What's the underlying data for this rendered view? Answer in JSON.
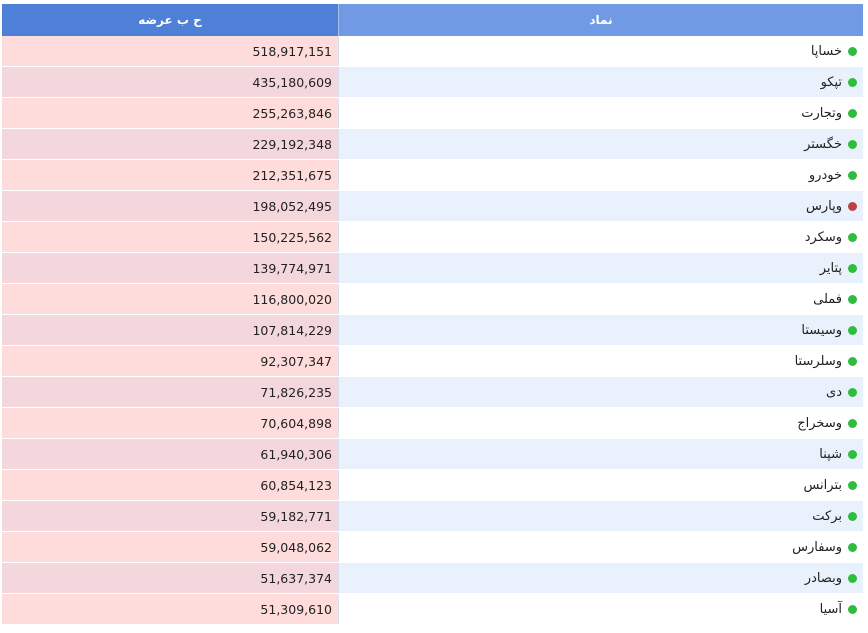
{
  "header": {
    "supply_label": "ح ب عرضه",
    "symbol_label": "نماد"
  },
  "colors": {
    "up": "#2ebd3c",
    "down": "#b94444"
  },
  "rows": [
    {
      "symbol": "خساپا",
      "value": "518,917,151",
      "status": "up"
    },
    {
      "symbol": "تپکو",
      "value": "435,180,609",
      "status": "up"
    },
    {
      "symbol": "وتجارت",
      "value": "255,263,846",
      "status": "up"
    },
    {
      "symbol": "خگستر",
      "value": "229,192,348",
      "status": "up"
    },
    {
      "symbol": "خودرو",
      "value": "212,351,675",
      "status": "up"
    },
    {
      "symbol": "وپارس",
      "value": "198,052,495",
      "status": "down"
    },
    {
      "symbol": "وسکرد",
      "value": "150,225,562",
      "status": "up"
    },
    {
      "symbol": "پتایر",
      "value": "139,774,971",
      "status": "up"
    },
    {
      "symbol": "فملی",
      "value": "116,800,020",
      "status": "up"
    },
    {
      "symbol": "وسیستا",
      "value": "107,814,229",
      "status": "up"
    },
    {
      "symbol": "وسلرستا",
      "value": "92,307,347",
      "status": "up"
    },
    {
      "symbol": "دی",
      "value": "71,826,235",
      "status": "up"
    },
    {
      "symbol": "وسخراج",
      "value": "70,604,898",
      "status": "up"
    },
    {
      "symbol": "شپنا",
      "value": "61,940,306",
      "status": "up"
    },
    {
      "symbol": "بترانس",
      "value": "60,854,123",
      "status": "up"
    },
    {
      "symbol": "برکت",
      "value": "59,182,771",
      "status": "up"
    },
    {
      "symbol": "وسفارس",
      "value": "59,048,062",
      "status": "up"
    },
    {
      "symbol": "وبصادر",
      "value": "51,637,374",
      "status": "up"
    },
    {
      "symbol": "آسیا",
      "value": "51,309,610",
      "status": "up"
    }
  ]
}
